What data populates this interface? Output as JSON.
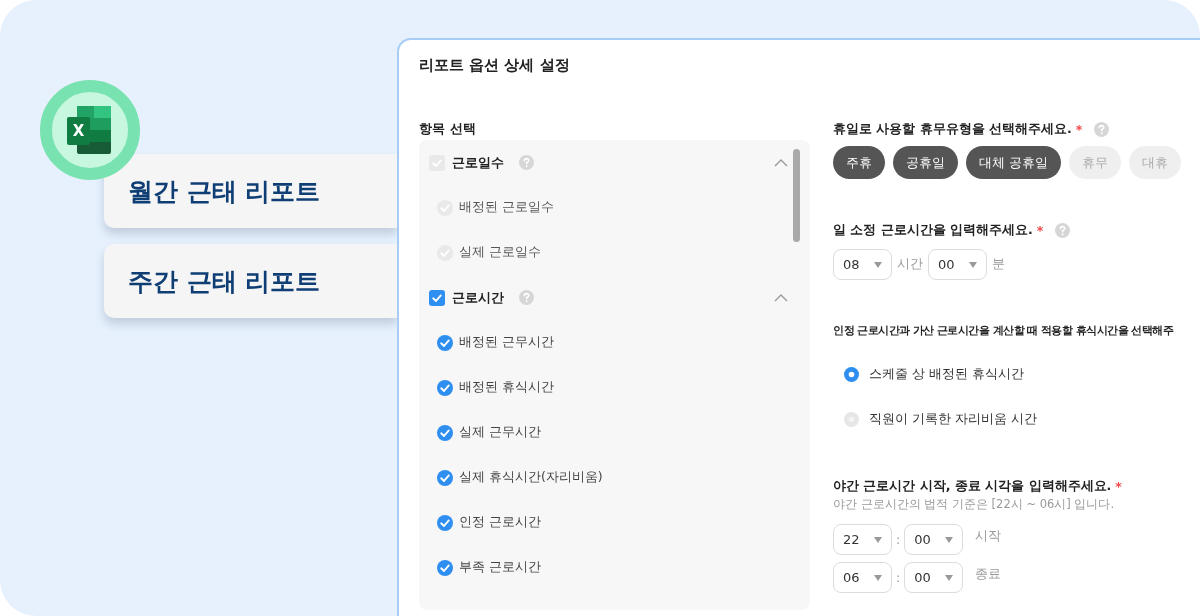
{
  "logo": {
    "letter": "X"
  },
  "report_cards": [
    {
      "label": "월간 근태 리포트"
    },
    {
      "label": "주간 근태 리포트"
    }
  ],
  "dialog": {
    "title": "리포트 옵션 상세 설정",
    "item_select": {
      "heading": "항목 선택",
      "groups": [
        {
          "label": "근로일수",
          "checked": true,
          "disabled": true,
          "expanded": true,
          "children": [
            {
              "label": "배정된 근로일수",
              "checked": true,
              "disabled": true
            },
            {
              "label": "실제 근로일수",
              "checked": true,
              "disabled": true
            }
          ]
        },
        {
          "label": "근로시간",
          "checked": true,
          "disabled": false,
          "expanded": true,
          "children": [
            {
              "label": "배정된 근무시간",
              "checked": true,
              "disabled": false
            },
            {
              "label": "배정된 휴식시간",
              "checked": true,
              "disabled": false
            },
            {
              "label": "실제 근무시간",
              "checked": true,
              "disabled": false
            },
            {
              "label": "실제 휴식시간(자리비움)",
              "checked": true,
              "disabled": false
            },
            {
              "label": "인정 근로시간",
              "checked": true,
              "disabled": false
            },
            {
              "label": "부족 근로시간",
              "checked": true,
              "disabled": false
            }
          ]
        }
      ]
    },
    "holiday_types": {
      "label": "휴일로 사용할 휴무유형을 선택해주세요.",
      "required_mark": "*",
      "chips": [
        {
          "label": "주휴",
          "selected": true
        },
        {
          "label": "공휴일",
          "selected": true
        },
        {
          "label": "대체 공휴일",
          "selected": true
        },
        {
          "label": "휴무",
          "selected": false
        },
        {
          "label": "대휴",
          "selected": false
        }
      ]
    },
    "daily_hours": {
      "label": "일 소정 근로시간을 입력해주세요.",
      "required_mark": "*",
      "hour": "08",
      "hour_unit": "시간",
      "minute": "00",
      "minute_unit": "분"
    },
    "break_time": {
      "label": "인정 근로시간과 가산 근로시간을 계산할 때 적용할 휴식시간을 선택해주",
      "options": [
        {
          "label": "스케줄 상 배정된 휴식시간",
          "selected": true
        },
        {
          "label": "직원이 기록한 자리비움 시간",
          "selected": false
        }
      ]
    },
    "night_hours": {
      "label": "야간 근로시간 시작, 종료 시각을 입력해주세요.",
      "required_mark": "*",
      "hint": "야간 근로시간의 법적 기준은 [22시 ~ 06시] 입니다.",
      "rows": [
        {
          "hour": "22",
          "separator": ":",
          "minute": "00",
          "label": "시작"
        },
        {
          "hour": "06",
          "separator": ":",
          "minute": "00",
          "label": "종료"
        }
      ]
    }
  }
}
